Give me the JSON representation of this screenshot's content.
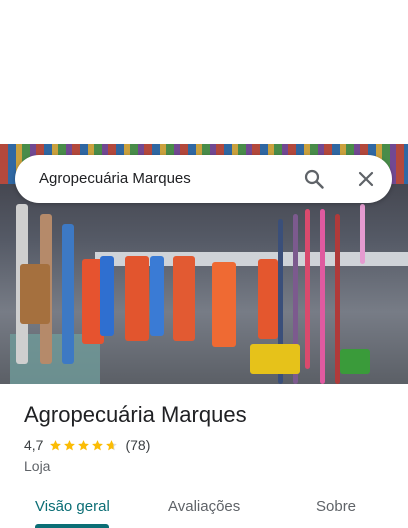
{
  "search": {
    "query": "Agropecuária Marques",
    "search_icon": "search-icon",
    "close_icon": "close-icon"
  },
  "place": {
    "name": "Agropecuária Marques",
    "rating": "4,7",
    "rating_value": 4.7,
    "star_color": "#fbbc04",
    "review_count": "(78)",
    "category": "Loja"
  },
  "tabs": [
    {
      "label": "Visão geral",
      "selected": true
    },
    {
      "label": "Avaliações",
      "selected": false
    },
    {
      "label": "Sobre",
      "selected": false
    }
  ],
  "colors": {
    "accent": "#0b6e75",
    "text_primary": "#202124",
    "text_secondary": "#5f6368"
  }
}
